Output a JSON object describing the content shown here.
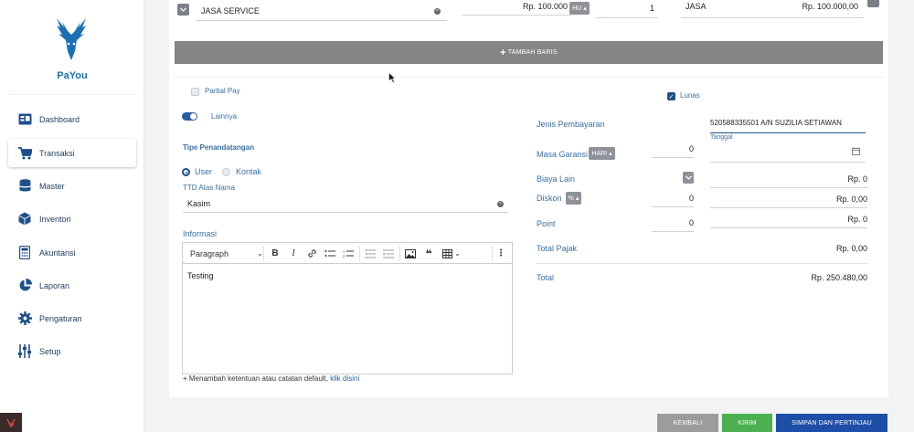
{
  "brand": {
    "name_pa": "Pa",
    "name_you": "You",
    "logo_icon": "deer-head-icon",
    "color": "#1a6fb5"
  },
  "sidebar": {
    "items": [
      {
        "label": "Dashboard",
        "icon": "dashboard-icon",
        "active": false
      },
      {
        "label": "Transaksi",
        "icon": "cart-icon",
        "active": true
      },
      {
        "label": "Master",
        "icon": "database-icon",
        "active": false
      },
      {
        "label": "Inventori",
        "icon": "box-icon",
        "active": false
      },
      {
        "label": "Akuntansi",
        "icon": "calculator-icon",
        "active": false
      },
      {
        "label": "Laporan",
        "icon": "pie-chart-icon",
        "active": false
      },
      {
        "label": "Pengaturan",
        "icon": "gear-icon",
        "active": false
      },
      {
        "label": "Setup",
        "icon": "sliders-icon",
        "active": false
      }
    ]
  },
  "line_item": {
    "name": "JASA SERVICE",
    "price": "Rp. 100.000",
    "price_unit_tag": "HU",
    "qty": "1",
    "unit": "JASA",
    "subtotal": "Rp. 100.000,00"
  },
  "add_row_label": "TAMBAH BARIS",
  "left": {
    "partial_pay_label": "Partial Pay",
    "lainnya_label": "Lainnya",
    "tipe_label": "Tipe Penandatangan",
    "radio_user": "User",
    "radio_kontak": "Kontak",
    "ttd_label": "TTD Atas Nama",
    "ttd_value": "Kasim",
    "informasi_label": "Informasi",
    "paragraph_select": "Paragraph",
    "editor_content": "Testing",
    "hint_text": "+ Menambah ketentuan atau catatan default,",
    "hint_link": "klik disini"
  },
  "right": {
    "lunas_label": "Lunas",
    "jenis_label": "Jenis Pembayaran",
    "jenis_value": "520588335501 A/N SUZILIA SETIAWAN",
    "tanggal_label": "Tanggal",
    "masa_label": "Masa Garansi",
    "masa_unit": "HARI",
    "masa_value": "0",
    "biaya_label": "Biaya Lain",
    "biaya_value": "Rp. 0",
    "diskon_label": "Diskon",
    "diskon_unit": "%",
    "diskon_input": "0",
    "diskon_value": "Rp. 0,00",
    "point_label": "Point",
    "point_input": "0",
    "point_value": "Rp. 0",
    "pajak_label": "Total Pajak",
    "pajak_value": "Rp. 0,00",
    "total_label": "Total",
    "total_value": "Rp. 250.480,00"
  },
  "footer": {
    "kembali": "KEMBALI",
    "kirim": "KIRIM",
    "simpan": "SIMPAN DAN PERTINJAU"
  },
  "colors": {
    "accent": "#1e4f8c",
    "kembali_bg": "#9c9c9c",
    "kirim_bg": "#4caf50",
    "simpan_bg": "#1e4fa8"
  }
}
